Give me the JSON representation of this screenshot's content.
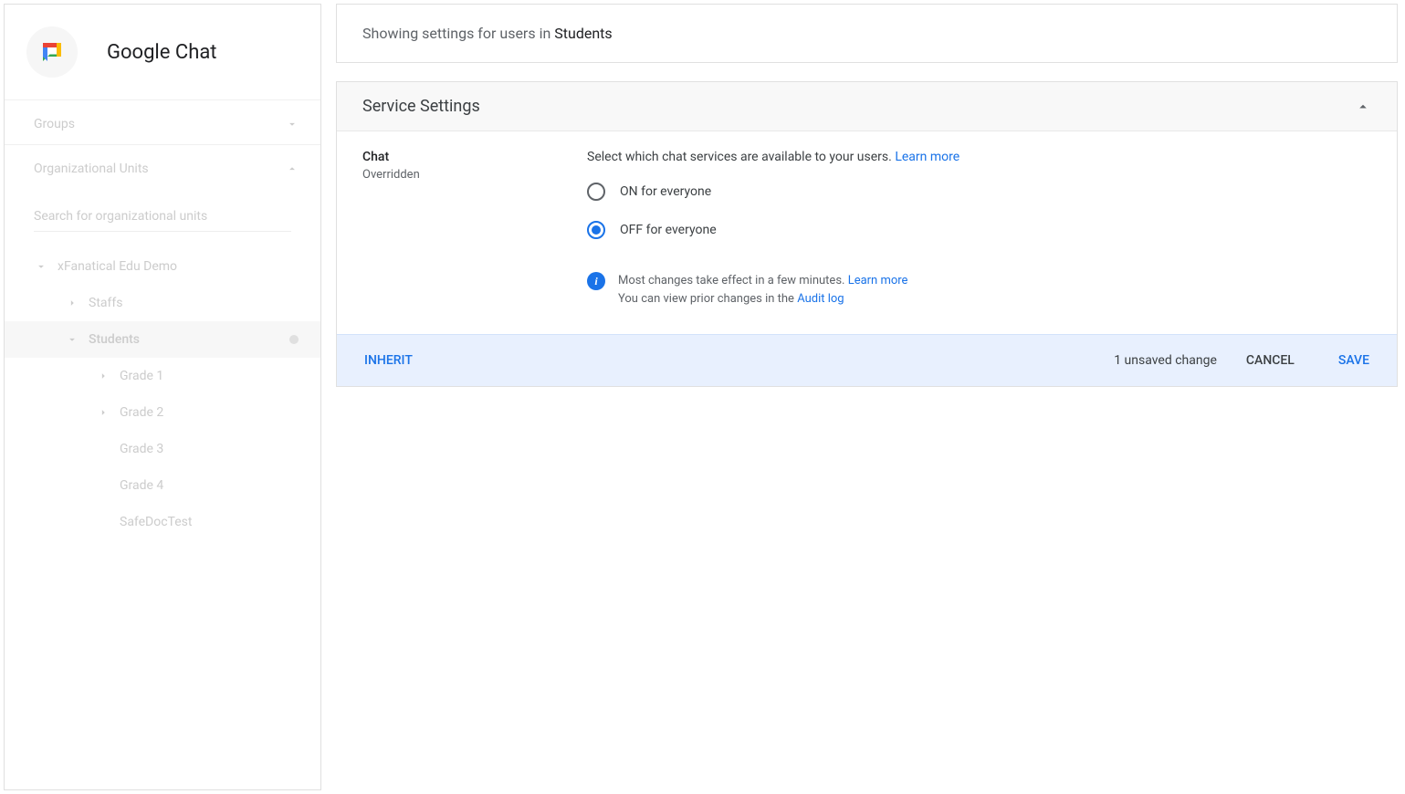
{
  "app": {
    "title": "Google Chat"
  },
  "sidebar": {
    "groups_label": "Groups",
    "org_units_label": "Organizational Units",
    "search_placeholder": "Search for organizational units",
    "tree": {
      "root": "xFanatical Edu Demo",
      "items": [
        {
          "label": "Staffs"
        },
        {
          "label": "Students"
        },
        {
          "label": "Grade 1"
        },
        {
          "label": "Grade 2"
        },
        {
          "label": "Grade 3"
        },
        {
          "label": "Grade 4"
        },
        {
          "label": "SafeDocTest"
        }
      ]
    }
  },
  "main": {
    "context_prefix": "Showing settings for users in ",
    "context_ou": "Students",
    "card": {
      "title": "Service Settings",
      "setting_label": "Chat",
      "setting_sublabel": "Overridden",
      "description": "Select which chat services are available to your users. ",
      "learn_more": "Learn more",
      "options": {
        "on": "ON for everyone",
        "off": "OFF for everyone"
      },
      "info": {
        "line1_a": "Most changes take effect in a few minutes. ",
        "line1_link": "Learn more",
        "line2_a": "You can view prior changes in the ",
        "line2_link": "Audit log"
      },
      "footer": {
        "inherit": "INHERIT",
        "unsaved": "1 unsaved change",
        "cancel": "CANCEL",
        "save": "SAVE"
      }
    }
  }
}
